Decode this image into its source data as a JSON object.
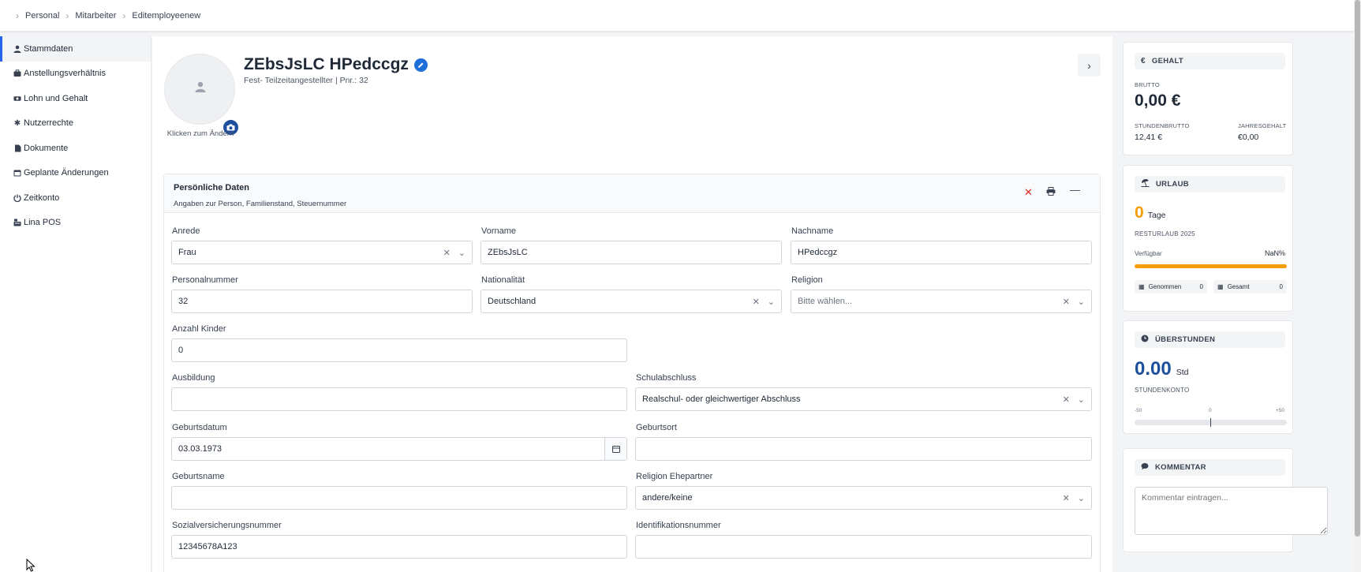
{
  "breadcrumb": [
    "Personal",
    "Mitarbeiter",
    "Editemployeenew"
  ],
  "sidebar": {
    "items": [
      {
        "label": "Stammdaten",
        "icon": "user-icon"
      },
      {
        "label": "Anstellungsverhältnis",
        "icon": "briefcase-icon"
      },
      {
        "label": "Lohn und Gehalt",
        "icon": "money-icon"
      },
      {
        "label": "Nutzerrechte",
        "icon": "gear-icon"
      },
      {
        "label": "Dokumente",
        "icon": "document-icon"
      },
      {
        "label": "Geplante Änderungen",
        "icon": "calendar-icon"
      },
      {
        "label": "Zeitkonto",
        "icon": "power-icon"
      },
      {
        "label": "Lina POS",
        "icon": "cash-register-icon"
      }
    ]
  },
  "profile": {
    "name": "ZEbsJsLC HPedccgz",
    "subtitle": "Fest- Teilzeitangestellter | Pnr.: 32",
    "avatar_caption": "Klicken zum Ändern"
  },
  "card": {
    "title": "Persönliche Daten",
    "subtitle": "Angaben zur Person, Familienstand, Steuernummer"
  },
  "fields": {
    "anrede": {
      "label": "Anrede",
      "value": "Frau"
    },
    "vorname": {
      "label": "Vorname",
      "value": "ZEbsJsLC"
    },
    "nachname": {
      "label": "Nachname",
      "value": "HPedccgz"
    },
    "personalnummer": {
      "label": "Personalnummer",
      "value": "32"
    },
    "nationalitaet": {
      "label": "Nationalität",
      "value": "Deutschland"
    },
    "religion": {
      "label": "Religion",
      "placeholder": "Bitte wählen..."
    },
    "kinder": {
      "label": "Anzahl Kinder",
      "value": "0"
    },
    "ausbildung": {
      "label": "Ausbildung",
      "value": ""
    },
    "schulabschluss": {
      "label": "Schulabschluss",
      "value": "Realschul- oder gleichwertiger Abschluss"
    },
    "geburtsdatum": {
      "label": "Geburtsdatum",
      "value": "03.03.1973"
    },
    "geburtsort": {
      "label": "Geburtsort",
      "value": ""
    },
    "geburtsname": {
      "label": "Geburtsname",
      "value": ""
    },
    "religion_ehepartner": {
      "label": "Religion Ehepartner",
      "value": "andere/keine"
    },
    "svnr": {
      "label": "Sozialversicherungsnummer",
      "value": "12345678A123"
    },
    "idnr": {
      "label": "Identifikationsnummer",
      "value": ""
    }
  },
  "gehalt": {
    "title": "GEHALT",
    "brutto_label": "BRUTTO",
    "brutto": "0,00 €",
    "stundenbrutto_label": "STUNDENBRUTTO",
    "stundenbrutto": "12,41 €",
    "jahresgehalt_label": "JAHRESGEHALT",
    "jahresgehalt": "€0,00"
  },
  "urlaub": {
    "title": "URLAUB",
    "days": "0",
    "days_unit": "Tage",
    "rest_label": "RESTURLAUB 2025",
    "available_label": "Verfügbar",
    "available_pct": "NaN%",
    "bar_fill_fraction": 1.0,
    "genommen_label": "Genommen",
    "genommen": "0",
    "gesamt_label": "Gesamt",
    "gesamt": "0"
  },
  "ueberstunden": {
    "title": "ÜBERSTUNDEN",
    "value": "0.00",
    "unit": "Std",
    "konto_label": "STUNDENKONTO",
    "scale_min": "-50",
    "scale_mid": "0",
    "scale_max": "+50"
  },
  "kommentar": {
    "title": "KOMMENTAR",
    "placeholder": "Kommentar eintragen..."
  },
  "colors": {
    "accent": "#2563eb",
    "brand_blue": "#1e4f9c",
    "orange": "#f59e0b",
    "danger": "#dc2626"
  }
}
